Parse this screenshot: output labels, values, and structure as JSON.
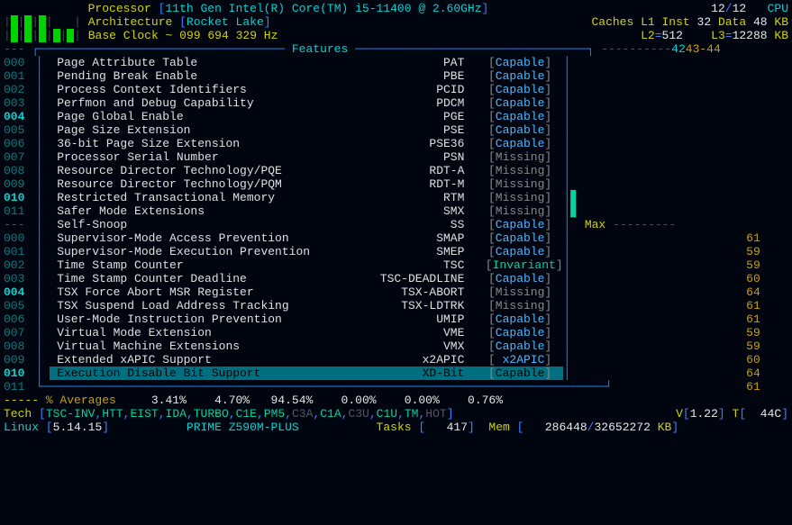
{
  "header": {
    "proc_label": "Processor",
    "proc_value": "11th Gen Intel(R) Core(TM) i5-11400 @ 2.60GHz",
    "cores": "12",
    "cores_total": "12",
    "cpu_label": "CPU",
    "arch_label": "Architecture",
    "arch_value": "Rocket Lake",
    "caches_label": "Caches",
    "l1_inst": "L1 Inst",
    "l1_inst_val": "32",
    "data_label": "Data",
    "data_val": "48",
    "kb": "KB",
    "base_clock_label": "Base Clock",
    "clock_val": "~ 099 694 329 Hz",
    "l2_label": "L2",
    "l2_val": "512",
    "l3_label": "L3",
    "l3_val": "12288"
  },
  "box_title": " Features ",
  "features": [
    {
      "ln": "000",
      "bold": false,
      "name": "Page Attribute Table",
      "code": "PAT",
      "st": "Capable",
      "cls": "cap"
    },
    {
      "ln": "001",
      "bold": false,
      "name": "Pending Break Enable",
      "code": "PBE",
      "st": "Capable",
      "cls": "cap"
    },
    {
      "ln": "002",
      "bold": false,
      "name": "Process Context Identifiers",
      "code": "PCID",
      "st": "Capable",
      "cls": "cap"
    },
    {
      "ln": "003",
      "bold": false,
      "name": "Perfmon and Debug Capability",
      "code": "PDCM",
      "st": "Capable",
      "cls": "cap"
    },
    {
      "ln": "004",
      "bold": true,
      "name": "Page Global Enable",
      "code": "PGE",
      "st": "Capable",
      "cls": "cap"
    },
    {
      "ln": "005",
      "bold": false,
      "name": "Page Size Extension",
      "code": "PSE",
      "st": "Capable",
      "cls": "cap"
    },
    {
      "ln": "006",
      "bold": false,
      "name": "36-bit Page Size Extension",
      "code": "PSE36",
      "st": "Capable",
      "cls": "cap"
    },
    {
      "ln": "007",
      "bold": false,
      "name": "Processor Serial Number",
      "code": "PSN",
      "st": "Missing",
      "cls": "miss"
    },
    {
      "ln": "008",
      "bold": false,
      "name": "Resource Director Technology/PQE",
      "code": "RDT-A",
      "st": "Missing",
      "cls": "miss"
    },
    {
      "ln": "009",
      "bold": false,
      "name": "Resource Director Technology/PQM",
      "code": "RDT-M",
      "st": "Missing",
      "cls": "miss"
    },
    {
      "ln": "010",
      "bold": true,
      "name": "Restricted Transactional Memory",
      "code": "RTM",
      "st": "Missing",
      "cls": "miss"
    },
    {
      "ln": "011",
      "bold": false,
      "name": "Safer Mode Extensions",
      "code": "SMX",
      "st": "Missing",
      "cls": "miss"
    },
    {
      "ln": "---",
      "bold": false,
      "name": "Self-Snoop",
      "code": "SS",
      "st": "Capable",
      "cls": "cap",
      "dash": true
    },
    {
      "ln": "000",
      "bold": false,
      "name": "Supervisor-Mode Access Prevention",
      "code": "SMAP",
      "st": "Capable",
      "cls": "cap"
    },
    {
      "ln": "001",
      "bold": false,
      "name": "Supervisor-Mode Execution Prevention",
      "code": "SMEP",
      "st": "Capable",
      "cls": "cap"
    },
    {
      "ln": "002",
      "bold": false,
      "name": "Time Stamp Counter",
      "code": "TSC",
      "st": "Invariant",
      "cls": "inv"
    },
    {
      "ln": "003",
      "bold": false,
      "name": "Time Stamp Counter Deadline",
      "code": "TSC-DEADLINE",
      "st": "Capable",
      "cls": "cap"
    },
    {
      "ln": "004",
      "bold": true,
      "name": "TSX Force Abort MSR Register",
      "code": "TSX-ABORT",
      "st": "Missing",
      "cls": "miss"
    },
    {
      "ln": "005",
      "bold": false,
      "name": "TSX Suspend Load Address Tracking",
      "code": "TSX-LDTRK",
      "st": "Missing",
      "cls": "miss"
    },
    {
      "ln": "006",
      "bold": false,
      "name": "User-Mode Instruction Prevention",
      "code": "UMIP",
      "st": "Capable",
      "cls": "cap"
    },
    {
      "ln": "007",
      "bold": false,
      "name": "Virtual Mode Extension",
      "code": "VME",
      "st": "Capable",
      "cls": "cap"
    },
    {
      "ln": "008",
      "bold": false,
      "name": "Virtual Machine Extensions",
      "code": "VMX",
      "st": "Capable",
      "cls": "cap"
    },
    {
      "ln": "009",
      "bold": false,
      "name": "Extended xAPIC Support",
      "code": "x2APIC",
      "st": " x2APIC",
      "cls": "x2"
    },
    {
      "ln": "010",
      "bold": true,
      "name": "Execution Disable Bit Support",
      "code": "XD-Bit",
      "st": "Capable",
      "cls": "cap",
      "hl": true
    }
  ],
  "max_label": "Max",
  "temps": [
    "",
    "",
    "",
    "",
    "",
    "",
    "",
    "",
    "",
    "",
    "",
    "",
    "",
    "61",
    "59",
    "59",
    "60",
    "64",
    "61",
    "61",
    "59",
    "59",
    "60",
    "64"
  ],
  "page_ind": "43-44",
  "page_total": "42",
  "last_row_ln": "011",
  "last_row_temp": "61",
  "averages_label": "% Averages",
  "avg_dashes": "-----",
  "averages": [
    "3.41%",
    "4.70%",
    "94.54%",
    "0.00%",
    "0.00%",
    "0.76%"
  ],
  "tech_label": "Tech",
  "tech_list": [
    {
      "t": "TSC-INV",
      "c": "teal"
    },
    {
      "t": ",",
      "c": "blue"
    },
    {
      "t": "HTT",
      "c": "teal"
    },
    {
      "t": ",",
      "c": "blue"
    },
    {
      "t": "EIST",
      "c": "teal"
    },
    {
      "t": ",",
      "c": "blue"
    },
    {
      "t": "IDA",
      "c": "teal"
    },
    {
      "t": ",",
      "c": "blue"
    },
    {
      "t": "TURBO",
      "c": "teal"
    },
    {
      "t": ",",
      "c": "blue"
    },
    {
      "t": "C1E",
      "c": "teal"
    },
    {
      "t": ",",
      "c": "blue"
    },
    {
      "t": "PM5",
      "c": "teal"
    },
    {
      "t": ",",
      "c": "blue"
    },
    {
      "t": "C3A",
      "c": "dim"
    },
    {
      "t": ",",
      "c": "blue"
    },
    {
      "t": "C1A",
      "c": "teal"
    },
    {
      "t": ",",
      "c": "blue"
    },
    {
      "t": "C3U",
      "c": "dim"
    },
    {
      "t": ",",
      "c": "blue"
    },
    {
      "t": "C1U",
      "c": "teal"
    },
    {
      "t": ",",
      "c": "blue"
    },
    {
      "t": "TM",
      "c": "teal"
    },
    {
      "t": ",",
      "c": "blue"
    },
    {
      "t": "HOT",
      "c": "dim"
    }
  ],
  "version_label": "V",
  "version": "1.22",
  "temp_label": "T",
  "sys_temp": "44C",
  "os_label": "Linux",
  "kernel": "5.14.15",
  "mobo": "PRIME Z590M-PLUS",
  "tasks_label": "Tasks",
  "tasks_val": "417",
  "mem_label": "Mem",
  "mem_used": "286448",
  "mem_total": "32652272"
}
